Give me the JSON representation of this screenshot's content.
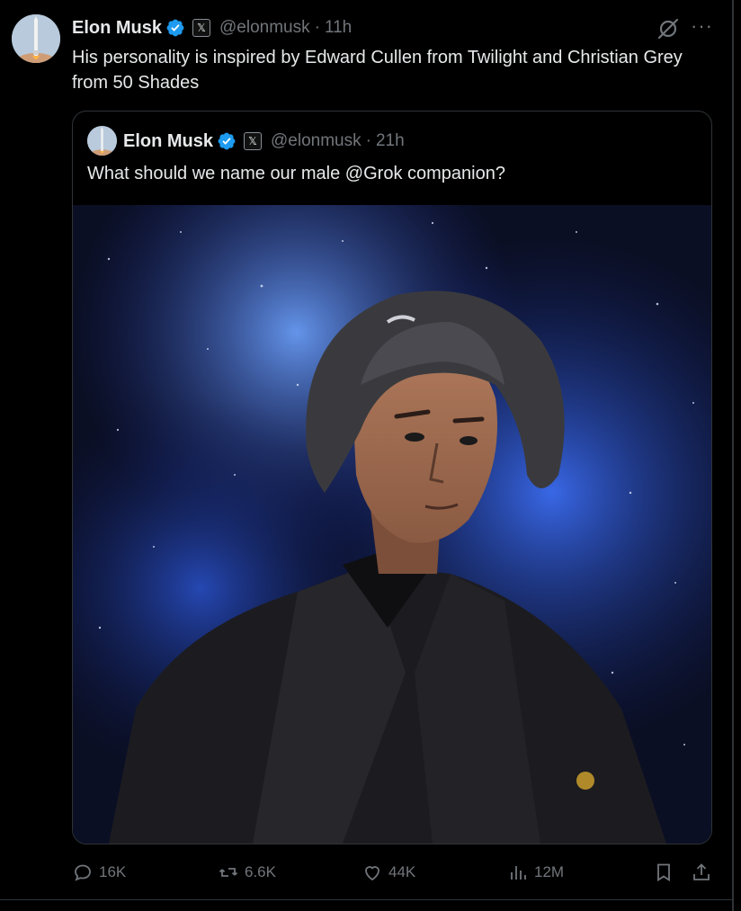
{
  "post": {
    "author_name": "Elon Musk",
    "x_badge": "𝕏",
    "handle": "@elonmusk",
    "separator": "·",
    "time": "11h",
    "text": "His personality is inspired by Edward Cullen from Twilight and Christian Grey from 50 Shades",
    "more": "···"
  },
  "quoted": {
    "author_name": "Elon Musk",
    "x_badge": "𝕏",
    "handle": "@elonmusk",
    "separator": "·",
    "time": "21h",
    "text": "What should we name our male @Grok companion?"
  },
  "actions": {
    "replies": "16K",
    "reposts": "6.6K",
    "likes": "44K",
    "views": "12M"
  },
  "colors": {
    "background": "#000000",
    "text": "#e7e9ea",
    "muted": "#71767b",
    "verified": "#1d9bf0",
    "border": "#2f3336"
  },
  "icons": [
    "verified-badge-icon",
    "grok-icon",
    "more-icon",
    "reply-icon",
    "repost-icon",
    "like-icon",
    "views-icon",
    "bookmark-icon",
    "share-icon"
  ]
}
